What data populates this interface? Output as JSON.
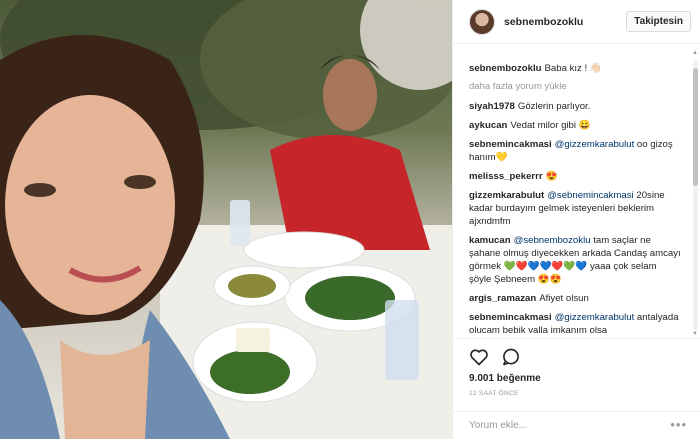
{
  "post": {
    "username": "sebnembozoklu",
    "follow_label": "Takiptesin",
    "caption": {
      "user": "sebnembozoklu",
      "text": "Baba kız ! 👋🏻"
    },
    "load_more": "daha fazla yorum yükle",
    "comments": [
      {
        "user": "siyah1978",
        "text": "Gözlerin parlıyor."
      },
      {
        "user": "aykucan",
        "text": "Vedat milor gibi 😀"
      },
      {
        "user": "sebnemincakmasi",
        "mention": "@gizzemkarabulut",
        "text": " oo gizoş hanım💛"
      },
      {
        "user": "melisss_pekerrr",
        "text": "😍"
      },
      {
        "user": "gizzemkarabulut",
        "mention": "@sebnemincakmasi",
        "text": " 20sine kadar burdayım gelmek isteyenleri beklerim ajxndmfm"
      },
      {
        "user": "kamucan",
        "mention": "@sebnembozoklu",
        "text": " tam saçlar ne şahane olmuş diyecekken arkada Candaş amcayı görmek 💚❤️💙💙❤️💚💙 yaaa çok selam şöyle Şebneem 😍😍"
      },
      {
        "user": "argis_ramazan",
        "text": "Afiyet olsun"
      },
      {
        "user": "sebnemincakmasi",
        "mention": "@gizzemkarabulut",
        "text": " antalyada olucam bebik valla imkanım olsa"
      }
    ],
    "likes": "9.001 beğenme",
    "time": "12 SAAT ÖNCE",
    "add_comment_placeholder": "Yorum ekle...",
    "icons": {
      "like": "heart-icon",
      "comment": "comment-icon",
      "options": "more-options-icon"
    },
    "colors": {
      "mention": "#003569",
      "muted": "#999999",
      "border": "#efefef"
    }
  }
}
